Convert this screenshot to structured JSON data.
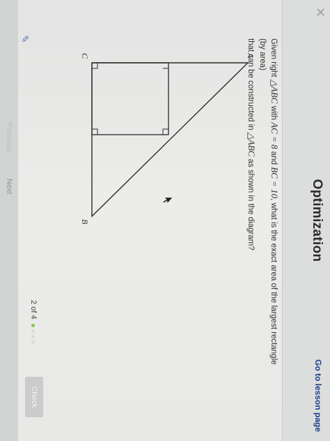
{
  "header": {
    "title": "Optimization",
    "lesson_link": "Go to lesson page",
    "close_icon": "close-icon"
  },
  "question": {
    "line1_a": "Given right ",
    "triangle": "△ABC",
    "line1_b": " with ",
    "ac": "AC = 8",
    "line1_c": " and ",
    "bc": "BC = 10",
    "line1_d": ", what is the exact area of the largest rectangle (by area)",
    "line2_a": "that can be constructed in ",
    "line2_b": " as shown in the diagram?"
  },
  "diagram": {
    "vertex_a": "A",
    "vertex_b": "B",
    "vertex_c": "C"
  },
  "progress": {
    "text": "2 of 4",
    "dot_colors": [
      "#8bc34a",
      "#d9dbd9",
      "#d9dbd9",
      "#d9dbd9"
    ]
  },
  "footer": {
    "check_label": "Check",
    "previous_label": "Previous",
    "next_label": "Next"
  }
}
